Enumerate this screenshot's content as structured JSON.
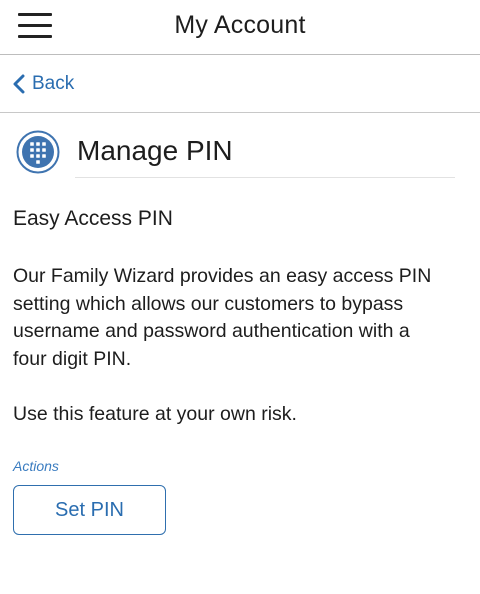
{
  "header": {
    "title": "My Account",
    "menu_icon": "hamburger-menu-icon"
  },
  "navigation": {
    "back_label": "Back",
    "back_icon": "chevron-left-icon"
  },
  "page": {
    "icon": "keypad-icon",
    "title": "Manage PIN"
  },
  "content": {
    "section_title": "Easy Access PIN",
    "description": "Our Family Wizard provides an easy access PIN setting which allows our customers to bypass username and password authentication with a four digit PIN.",
    "warning": "Use this feature at your own risk.",
    "actions_label": "Actions",
    "set_pin_label": "Set PIN"
  },
  "colors": {
    "accent": "#2a6db0",
    "icon_blue": "#3f74b0",
    "text": "#1d1d1d",
    "divider": "#bdbdbd"
  }
}
